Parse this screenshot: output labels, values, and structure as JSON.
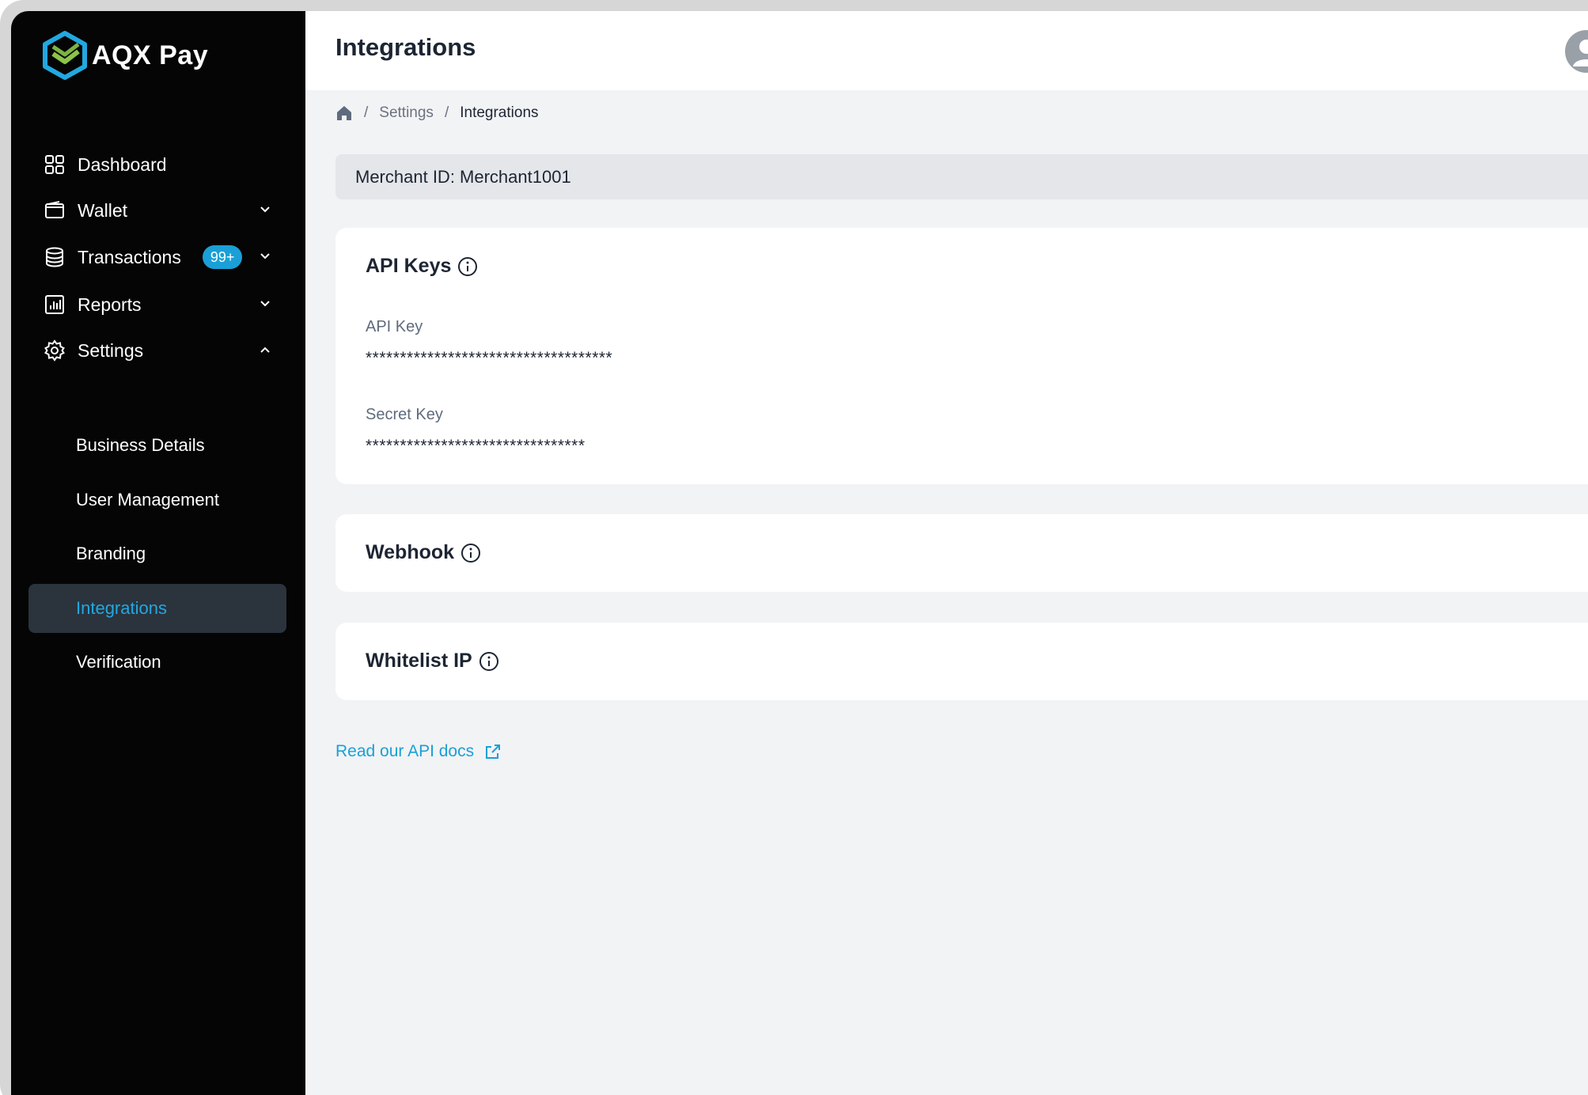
{
  "app": {
    "brand": "AQX Pay"
  },
  "sidebar": {
    "items": [
      {
        "label": "Dashboard",
        "icon": "dashboard-icon"
      },
      {
        "label": "Wallet",
        "icon": "wallet-icon"
      },
      {
        "label": "Transactions",
        "icon": "database-icon",
        "badge": "99+"
      },
      {
        "label": "Reports",
        "icon": "reports-icon"
      },
      {
        "label": "Settings",
        "icon": "gear-icon"
      }
    ],
    "settings_sub": [
      {
        "label": "Business Details"
      },
      {
        "label": "User Management"
      },
      {
        "label": "Branding"
      },
      {
        "label": "Integrations",
        "active": true
      },
      {
        "label": "Verification"
      }
    ]
  },
  "header": {
    "title": "Integrations"
  },
  "breadcrumb": {
    "home_icon": "home-icon",
    "items": [
      "Settings",
      "Integrations"
    ],
    "separator": "/"
  },
  "merchant": {
    "text": "Merchant ID: Merchant1001"
  },
  "api_keys": {
    "title": "API Keys",
    "api_key_label": "API Key",
    "api_key_value": "************************************",
    "secret_key_label": "Secret Key",
    "secret_key_value": "********************************"
  },
  "webhook": {
    "title": "Webhook"
  },
  "whitelist": {
    "title": "Whitelist IP"
  },
  "docs": {
    "label": "Read our API docs"
  },
  "colors": {
    "accent": "#1aa0d6",
    "sidebar_bg": "#050505",
    "active_bg": "#2b333d",
    "page_bg": "#f2f3f5"
  }
}
